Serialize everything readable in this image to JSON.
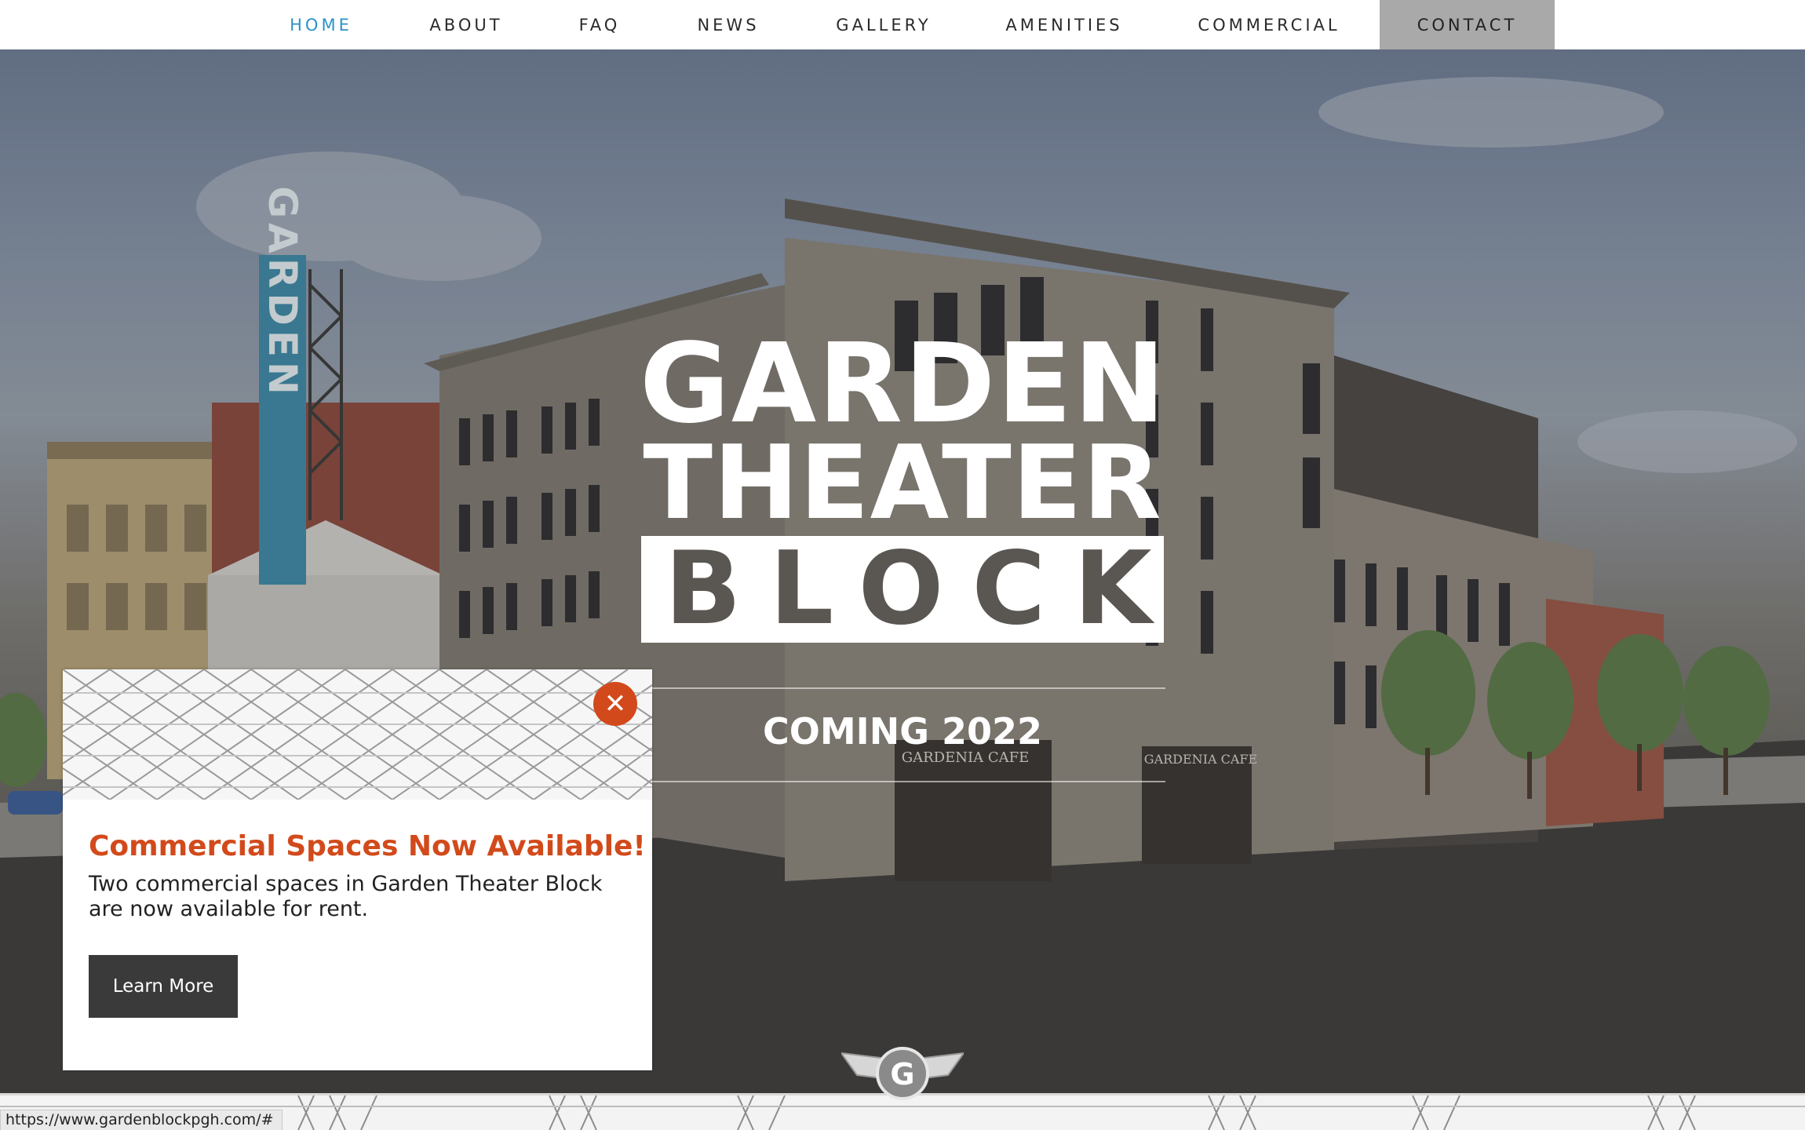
{
  "nav": {
    "items": [
      {
        "label": "HOME",
        "active": true
      },
      {
        "label": "ABOUT"
      },
      {
        "label": "FAQ"
      },
      {
        "label": "NEWS"
      },
      {
        "label": "GALLERY"
      },
      {
        "label": "AMENITIES"
      },
      {
        "label": "COMMERCIAL"
      },
      {
        "label": "CONTACT"
      }
    ]
  },
  "hero": {
    "title_line1": "GARDEN",
    "title_line2": "THEATER",
    "title_line3": "BLOCK",
    "subtitle": "COMING 2022",
    "sign_text": "GARDEN",
    "cafe_sign_1": "GARDENIA CAFE",
    "cafe_sign_2": "GARDENIA CAFE"
  },
  "popup": {
    "heading": "Commercial Spaces Now Available!",
    "body": "Two commercial spaces in Garden Theater Block are now available for rent.",
    "button_label": "Learn More",
    "close_icon": "close-icon"
  },
  "footer": {
    "emblem_letter": "G"
  },
  "status_bar": {
    "url": "https://www.gardenblockpgh.com/#"
  },
  "colors": {
    "accent": "#d24a1b",
    "nav_active": "#2a93c9",
    "contact_bg": "#a9a9a9",
    "button_bg": "#3a3a3a"
  }
}
